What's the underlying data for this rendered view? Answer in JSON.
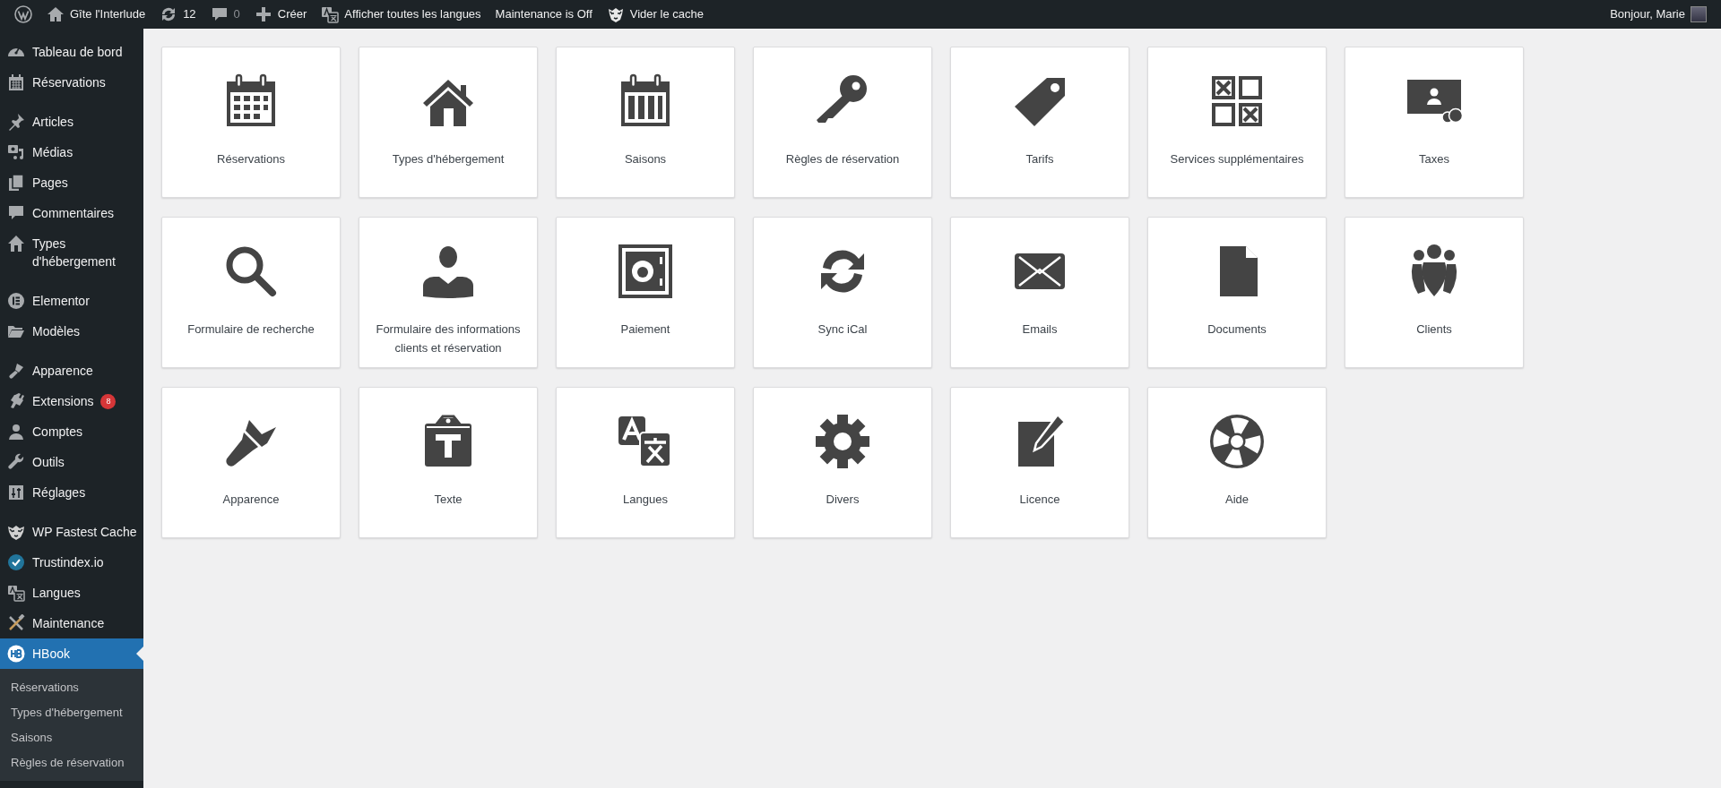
{
  "admin_bar": {
    "left": [
      {
        "label": "Gîte l'Interlude"
      },
      {
        "label": "12"
      },
      {
        "label": "0",
        "disabled": true
      },
      {
        "label": "Créer"
      },
      {
        "label": "Afficher toutes les langues"
      },
      {
        "label": "Maintenance is Off"
      },
      {
        "label": "Vider le cache"
      }
    ],
    "greeting": "Bonjour, Marie"
  },
  "sidebar": {
    "groups": [
      [
        {
          "label": "Tableau de bord",
          "selected": false
        },
        {
          "label": "Réservations",
          "selected": false
        }
      ],
      [
        {
          "label": "Articles",
          "selected": false
        },
        {
          "label": "Médias",
          "selected": false
        },
        {
          "label": "Pages",
          "selected": false
        },
        {
          "label": "Commentaires",
          "selected": false
        },
        {
          "label": "Types d'hébergement",
          "selected": false
        }
      ],
      [
        {
          "label": "Elementor",
          "selected": false
        },
        {
          "label": "Modèles",
          "selected": false
        }
      ],
      [
        {
          "label": "Apparence",
          "selected": false
        },
        {
          "label": "Extensions",
          "badge": "8",
          "selected": false
        },
        {
          "label": "Comptes",
          "selected": false
        },
        {
          "label": "Outils",
          "selected": false
        },
        {
          "label": "Réglages",
          "selected": false
        }
      ],
      [
        {
          "label": "WP Fastest Cache",
          "selected": false
        },
        {
          "label": "Trustindex.io",
          "selected": false
        },
        {
          "label": "Langues",
          "selected": false
        },
        {
          "label": "Maintenance",
          "selected": false
        },
        {
          "label": "HBook",
          "selected": true
        }
      ]
    ],
    "submenu": [
      {
        "label": "Réservations",
        "selected": false
      },
      {
        "label": "Types d'hébergement",
        "selected": false
      },
      {
        "label": "Saisons",
        "selected": false
      },
      {
        "label": "Règles de réservation",
        "selected": false
      }
    ]
  },
  "tiles": [
    {
      "label": "Réservations"
    },
    {
      "label": "Types d'hébergement"
    },
    {
      "label": "Saisons"
    },
    {
      "label": "Règles de réservation"
    },
    {
      "label": "Tarifs"
    },
    {
      "label": "Services supplémentaires"
    },
    {
      "label": "Taxes"
    },
    {
      "label": "Formulaire de recherche"
    },
    {
      "label": "Formulaire des informations clients et réservation"
    },
    {
      "label": "Paiement"
    },
    {
      "label": "Sync iCal"
    },
    {
      "label": "Emails"
    },
    {
      "label": "Documents"
    },
    {
      "label": "Clients"
    },
    {
      "label": "Apparence"
    },
    {
      "label": "Texte"
    },
    {
      "label": "Langues"
    },
    {
      "label": "Divers"
    },
    {
      "label": "Licence"
    },
    {
      "label": "Aide"
    }
  ]
}
